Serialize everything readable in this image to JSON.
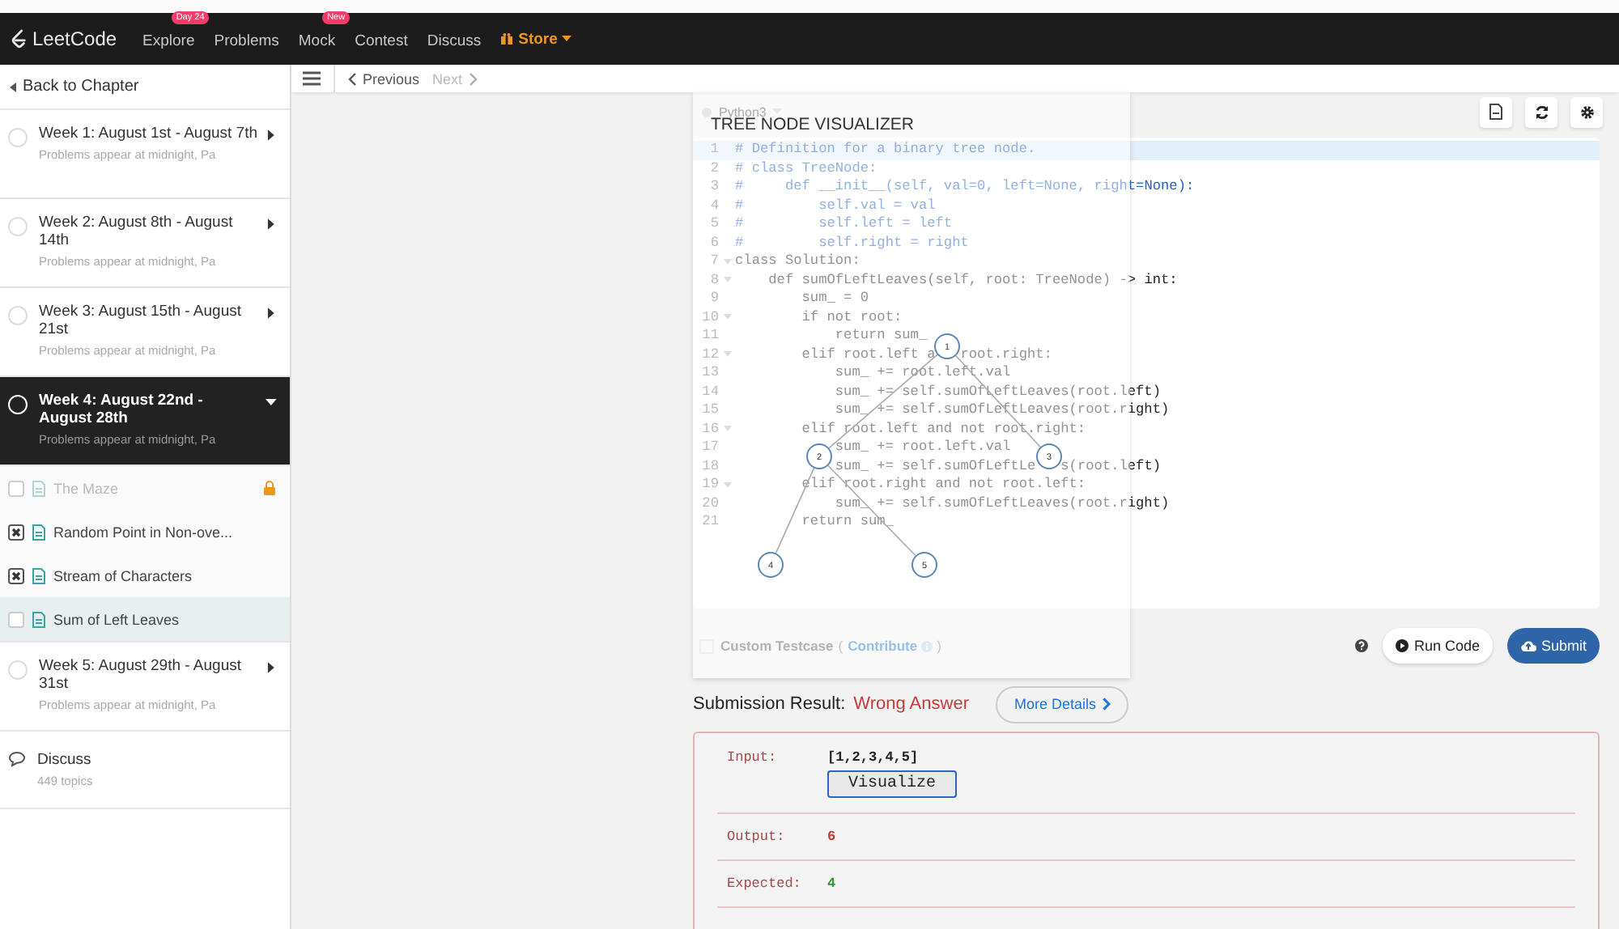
{
  "nav": {
    "logo": "LeetCode",
    "items": [
      {
        "label": "Explore",
        "badge": "Day 24",
        "kind": "link"
      },
      {
        "label": "Problems",
        "kind": "link"
      },
      {
        "label": "Mock",
        "badge": "New",
        "kind": "link"
      },
      {
        "label": "Contest",
        "kind": "link"
      },
      {
        "label": "Discuss",
        "kind": "link"
      },
      {
        "label": "Store",
        "kind": "store"
      }
    ]
  },
  "sidebar": {
    "back": "Back to Chapter",
    "weeks": [
      {
        "title": "Week 1: August 1st - August 7th",
        "subtitle": "Problems appear at midnight, Pa",
        "selected": false,
        "expanded": false
      },
      {
        "title": "Week 2: August 8th - August 14th",
        "subtitle": "Problems appear at midnight, Pa",
        "selected": false,
        "expanded": false
      },
      {
        "title": "Week 3: August 15th - August 21st",
        "subtitle": "Problems appear at midnight, Pa",
        "selected": false,
        "expanded": false
      },
      {
        "title": "Week 4: August 22nd - August 28th",
        "subtitle": "Problems appear at midnight, Pa",
        "selected": true,
        "expanded": true,
        "problems": [
          {
            "title": "The Maze",
            "attempted": false,
            "locked": true,
            "selected": false
          },
          {
            "title": "Random Point in Non-ove...",
            "attempted": true,
            "locked": false,
            "selected": false
          },
          {
            "title": "Stream of Characters",
            "attempted": true,
            "locked": false,
            "selected": false
          },
          {
            "title": "Sum of Left Leaves",
            "attempted": false,
            "locked": false,
            "selected": true
          }
        ]
      },
      {
        "title": "Week 5: August 29th - August 31st",
        "subtitle": "Problems appear at midnight, Pa",
        "selected": false,
        "expanded": false
      }
    ],
    "discuss": {
      "title": "Discuss",
      "count": "449 topics"
    }
  },
  "toolbar": {
    "previous": "Previous",
    "next": "Next",
    "next_disabled": true
  },
  "editor": {
    "language": "Python3",
    "lines": [
      {
        "number": "1",
        "text": "# Definition for a binary tree node.",
        "kind": "comment",
        "foldable": false,
        "active": true
      },
      {
        "number": "2",
        "text": "# class TreeNode:",
        "kind": "comment",
        "foldable": false,
        "active": false
      },
      {
        "number": "3",
        "text": "#     def __init__(self, val=0, left=None, right=None):",
        "kind": "comment",
        "foldable": false,
        "active": false
      },
      {
        "number": "4",
        "text": "#         self.val = val",
        "kind": "comment",
        "foldable": false,
        "active": false
      },
      {
        "number": "5",
        "text": "#         self.left = left",
        "kind": "comment",
        "foldable": false,
        "active": false
      },
      {
        "number": "6",
        "text": "#         self.right = right",
        "kind": "comment",
        "foldable": false,
        "active": false
      },
      {
        "number": "7",
        "text": "class Solution:",
        "kind": "code",
        "foldable": true,
        "active": false
      },
      {
        "number": "8",
        "text": "    def sumOfLeftLeaves(self, root: TreeNode) -> int:",
        "kind": "code",
        "foldable": true,
        "active": false
      },
      {
        "number": "9",
        "text": "        sum_ = 0",
        "kind": "code",
        "foldable": false,
        "active": false
      },
      {
        "number": "10",
        "text": "        if not root:",
        "kind": "code",
        "foldable": true,
        "active": false
      },
      {
        "number": "11",
        "text": "            return sum_",
        "kind": "code",
        "foldable": false,
        "active": false
      },
      {
        "number": "12",
        "text": "        elif root.left a",
        "after": "root.right:",
        "kind": "code",
        "foldable": true,
        "active": false
      },
      {
        "number": "13",
        "text": "            sum_ += root.left.val",
        "kind": "code",
        "foldable": false,
        "active": false
      },
      {
        "number": "14",
        "text": "            sum_ += self.sumOfLeftLeaves(root.left)",
        "kind": "code",
        "foldable": false,
        "active": false
      },
      {
        "number": "15",
        "text": "            sum_ += self.sumOfLeftLeaves(root.right)",
        "kind": "code",
        "foldable": false,
        "active": false
      },
      {
        "number": "16",
        "text": "        elif root.left and not root.right:",
        "kind": "code",
        "foldable": true,
        "active": false
      },
      {
        "number": "17",
        "text": "            sum_ += root.left.val",
        "kind": "code",
        "foldable": false,
        "active": false
      },
      {
        "number": "18",
        "text": "            sum_ += self.sumOfLeftLe",
        "after": "s(root.left)",
        "kind": "code",
        "foldable": false,
        "active": false
      },
      {
        "number": "19",
        "text": "        elif root.right and not root.left:",
        "kind": "code",
        "foldable": true,
        "active": false
      },
      {
        "number": "20",
        "text": "            sum_ += self.sumOfLeftLeaves(root.right)",
        "kind": "code",
        "foldable": false,
        "active": false
      },
      {
        "number": "21",
        "text": "        return sum_",
        "kind": "code",
        "foldable": false,
        "active": false
      }
    ]
  },
  "visualizer": {
    "title": "TREE NODE VISUALIZER",
    "nodes": [
      "1",
      "2",
      "3",
      "4",
      "5"
    ]
  },
  "testcase": {
    "label": "Custom Testcase",
    "open": "(",
    "link": "Contribute",
    "close": ")",
    "checked": false
  },
  "actions": {
    "run": "Run Code",
    "submit": "Submit"
  },
  "result": {
    "label": "Submission Result:",
    "status": "Wrong Answer",
    "details": "More Details",
    "rows": [
      {
        "label": "Input:",
        "value": "[1,2,3,4,5]",
        "kind": "input",
        "button": "Visualize"
      },
      {
        "label": "Output:",
        "value": "6",
        "kind": "output"
      },
      {
        "label": "Expected:",
        "value": "4",
        "kind": "expected"
      }
    ]
  }
}
